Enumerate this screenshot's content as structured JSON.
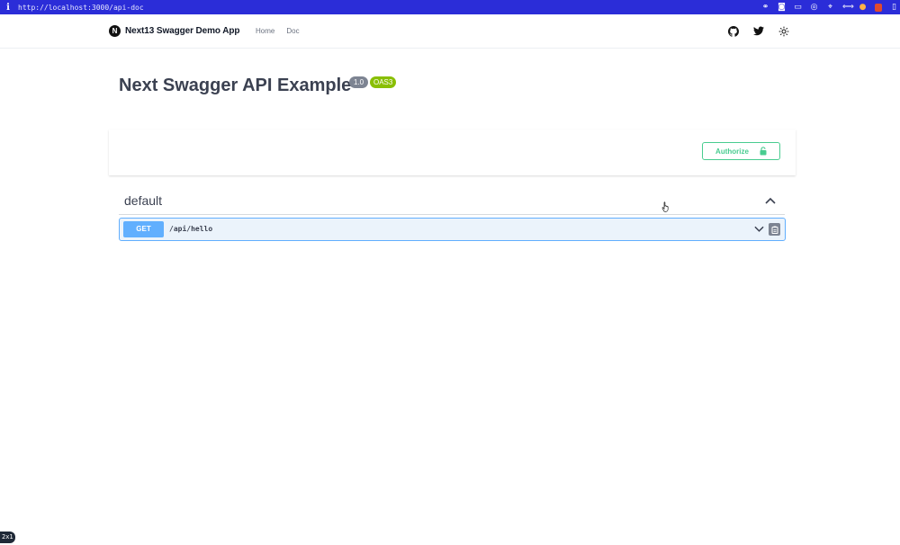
{
  "browser": {
    "info_glyph": "i",
    "url": "http://localhost:3000/api-doc"
  },
  "header": {
    "logo_letter": "N",
    "app_name": "Next13 Swagger Demo App",
    "nav": [
      {
        "label": "Home"
      },
      {
        "label": "Doc"
      }
    ],
    "icons": [
      "github-icon",
      "twitter-icon",
      "sun-icon"
    ]
  },
  "info": {
    "title": "Next Swagger API Example",
    "version": "1.0",
    "oas_badge": "OAS3"
  },
  "scheme": {
    "authorize_label": "Authorize"
  },
  "tag": {
    "name": "default",
    "expanded": true
  },
  "operations": [
    {
      "method": "GET",
      "path": "/api/hello",
      "method_color": "#61affe"
    }
  ],
  "colors": {
    "url_bar": "#2b2dd8",
    "authorize": "#49cc90",
    "get": "#61affe",
    "oas_badge": "#89bf04",
    "version_badge": "#7d8492"
  },
  "zoom_label": "2x1"
}
